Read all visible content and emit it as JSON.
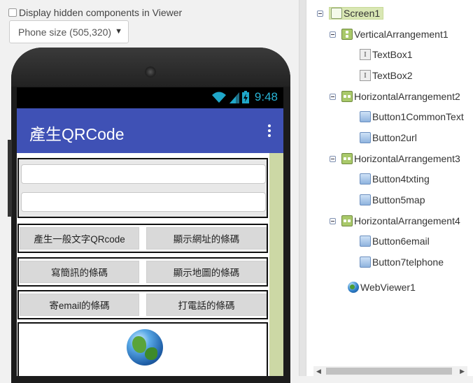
{
  "viewer": {
    "hidden_label": "Display hidden components in Viewer",
    "phone_size": "Phone size (505,320)",
    "status_time": "9:48",
    "app_title": "產生QRCode",
    "buttons": {
      "b1": "產生一般文字QRcode",
      "b2": "顯示網址的條碼",
      "b4": "寫簡訊的條碼",
      "b5": "顯示地圖的條碼",
      "b6": "寄email的條碼",
      "b7": "打電話的條碼"
    }
  },
  "tree": {
    "screen": "Screen1",
    "varr": "VerticalArrangement1",
    "tb1": "TextBox1",
    "tb2": "TextBox2",
    "harr2": "HorizontalArrangement2",
    "btn1": "Button1CommonText",
    "btn2": "Button2url",
    "harr3": "HorizontalArrangement3",
    "btn4": "Button4txting",
    "btn5": "Button5map",
    "harr4": "HorizontalArrangement4",
    "btn6": "Button6email",
    "btn7": "Button7telphone",
    "web": "WebViewer1"
  },
  "colors": {
    "titlebar": "#3f51b5",
    "selection": "#d9e7b4"
  }
}
